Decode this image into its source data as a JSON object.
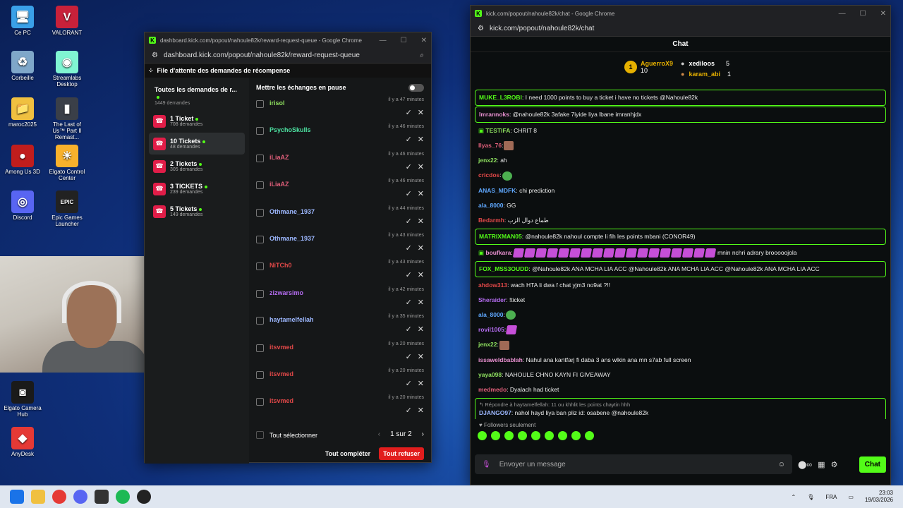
{
  "desktop": {
    "icons": [
      {
        "label": "Ce PC",
        "color": "#3aa0e8",
        "glyph": "🖥"
      },
      {
        "label": "VALORANT",
        "color": "#c8213a",
        "glyph": "V"
      },
      {
        "label": "Corbeille",
        "color": "#7fa7c9",
        "glyph": "♻"
      },
      {
        "label": "Streamlabs Desktop",
        "color": "#80f5d2",
        "glyph": "◉"
      },
      {
        "label": "maroc2025",
        "color": "#f0c040",
        "glyph": "📁"
      },
      {
        "label": "The Last of Us™ Part II Remast...",
        "color": "#3a3f48",
        "glyph": "▮"
      },
      {
        "label": "Among Us 3D",
        "color": "#c01d1d",
        "glyph": "●"
      },
      {
        "label": "Elgato Control Center",
        "color": "#f8b12c",
        "glyph": "☀"
      },
      {
        "label": "Discord",
        "color": "#5865f2",
        "glyph": "◎"
      },
      {
        "label": "Epic Games Launcher",
        "color": "#222",
        "glyph": "EPIC"
      },
      {
        "label": "Elgato Camera Hub",
        "color": "#1a1a1a",
        "glyph": "◙"
      },
      {
        "label": "AnyDesk",
        "color": "#e53935",
        "glyph": "◆"
      }
    ]
  },
  "dashboard": {
    "window_title": "dashboard.kick.com/popout/nahoule82k/reward-request-queue - Google Chrome",
    "url": "dashboard.kick.com/popout/nahoule82k/reward-request-queue",
    "header": "File d'attente des demandes de récompense",
    "sidebar": {
      "all_label": "Toutes les demandes de r...",
      "all_count": "1449 demandes",
      "items": [
        {
          "name": "1 Ticket",
          "count": "708 demandes"
        },
        {
          "name": "10 Tickets",
          "count": "48 demandes"
        },
        {
          "name": "2 Tickets",
          "count": "305 demandes"
        },
        {
          "name": "3 TICKETS",
          "count": "239 demandes"
        },
        {
          "name": "5 Tickets",
          "count": "149 demandes"
        }
      ]
    },
    "pause_label": "Mettre les échanges en pause",
    "requests": [
      {
        "user": "irisol",
        "color": "#8ee05f",
        "time": "il y a 47 minutes"
      },
      {
        "user": "PsychoSkulls",
        "color": "#4ce0a0",
        "time": "il y a 46 minutes"
      },
      {
        "user": "iLiaAZ",
        "color": "#e05f7a",
        "time": "il y a 46 minutes"
      },
      {
        "user": "iLiaAZ",
        "color": "#e05f7a",
        "time": "il y a 46 minutes"
      },
      {
        "user": "Othmane_1937",
        "color": "#9db8ff",
        "time": "il y a 44 minutes"
      },
      {
        "user": "Othmane_1937",
        "color": "#9db8ff",
        "time": "il y a 43 minutes"
      },
      {
        "user": "NiTCh0",
        "color": "#e04848",
        "time": "il y a 43 minutes"
      },
      {
        "user": "zizwarsimo",
        "color": "#b46cf0",
        "time": "il y a 42 minutes"
      },
      {
        "user": "haytamelfellah",
        "color": "#9db8ff",
        "time": "il y a 35 minutes"
      },
      {
        "user": "itsvmed",
        "color": "#e04848",
        "time": "il y a 20 minutes"
      },
      {
        "user": "itsvmed",
        "color": "#e04848",
        "time": "il y a 20 minutes"
      },
      {
        "user": "itsvmed",
        "color": "#e04848",
        "time": "il y a 20 minutes"
      }
    ],
    "select_all": "Tout sélectionner",
    "page": "1 sur 2",
    "complete_all": "Tout compléter",
    "refuse_all": "Tout refuser"
  },
  "chat": {
    "window_title": "kick.com/popout/nahoule82k/chat - Google Chrome",
    "url": "kick.com/popout/nahoule82k/chat",
    "title": "Chat",
    "leaderboard": {
      "first": {
        "rank": "1",
        "name": "AguerroX9",
        "value": "10"
      },
      "second": {
        "name": "xediloos",
        "value": "5"
      },
      "third": {
        "name": "karam_abi",
        "value": "1"
      }
    },
    "messages": [
      {
        "user": "MUKE_L3ROBI",
        "color": "#53fc18",
        "text": ": I need 1000 points to buy a ticket i have no tickets @Nahoule82k",
        "hl": true
      },
      {
        "user": "Imrannoks",
        "color": "#e890d0",
        "text": ": @nahoule82k 3afake 7iyide liya lbane imranhjdx",
        "hl": true
      },
      {
        "user": "TESTIFA",
        "color": "#8ee05f",
        "text": ": CHRIT 8",
        "badge": true
      },
      {
        "user": "Ilyas_76",
        "color": "#e05f7a",
        "text": ":",
        "emotes": [
          "d"
        ]
      },
      {
        "user": "jenx22",
        "color": "#8ee05f",
        "text": ": ah"
      },
      {
        "user": "cricdos",
        "color": "#e04848",
        "text": ":",
        "emotes": [
          "g"
        ]
      },
      {
        "user": "ANAS_MDFK",
        "color": "#5fa8ff",
        "text": ": chi prediction"
      },
      {
        "user": "ala_8000",
        "color": "#5fa8ff",
        "text": ": GG"
      },
      {
        "user": "Bedarmh",
        "color": "#e04848",
        "text": ": طماع دوال الزب"
      },
      {
        "user": "MATRIXMAN05",
        "color": "#53fc18",
        "text": ": @nahoule82k nahoul compte li fih les points mbani (CONOR49)",
        "hl": true
      },
      {
        "user": "boufkara",
        "color": "#e890d0",
        "text": ":",
        "emotes": [
          "p",
          "p",
          "p",
          "p",
          "p",
          "p",
          "p",
          "p",
          "p",
          "p",
          "p",
          "p",
          "p",
          "p",
          "p",
          "p",
          "p",
          "p"
        ],
        "after": " mnin nchri adrary brooooojola",
        "badge": true
      },
      {
        "user": "FOX_MSS3OUDD",
        "color": "#53fc18",
        "text": ": @Nahoule82k ANA MCHA LIA ACC @Nahoule82k ANA MCHA LIA ACC @Nahoule82k ANA MCHA LIA ACC",
        "hl": true
      },
      {
        "user": "ahdow313",
        "color": "#e04848",
        "text": ": wach HTA li dwa f chat yjm3 no9at ?!!"
      },
      {
        "user": "Sheraider",
        "color": "#b46cf0",
        "text": ": !ticket"
      },
      {
        "user": "ala_8000",
        "color": "#5fa8ff",
        "text": ":",
        "emotes": [
          "g"
        ]
      },
      {
        "user": "rovil1005",
        "color": "#b46cf0",
        "text": ":",
        "emotes": [
          "p"
        ]
      },
      {
        "user": "jenx22",
        "color": "#8ee05f",
        "text": ":",
        "emotes": [
          "d"
        ]
      },
      {
        "user": "issaweldbablah",
        "color": "#e890d0",
        "text": ": Nahul ana kantfarj fi daba 3 ans wlkin ana mn s7ab full screen"
      },
      {
        "user": "yaya098",
        "color": "#8ee05f",
        "text": ": NAHOULE CHNO KAYN FI GIVEAWAY"
      },
      {
        "user": "medmedo",
        "color": "#e05f7a",
        "text": ": Dyalach had ticket"
      },
      {
        "user": "DJANGO97",
        "color": "#9db8ff",
        "text": ": nahol hayd liya ban pliz id: osabene @nahoule82k",
        "hl": true,
        "reply": "↰ Répondre à haytamelfellah: 11 ou khhlit les points chaytin hhh"
      },
      {
        "user": "jenx22",
        "color": "#8ee05f",
        "text": ":",
        "emotes": [
          "d"
        ]
      }
    ],
    "followers_only": "♥ Followers seulement",
    "input_placeholder": "Envoyer un message",
    "send_label": "Chat"
  },
  "taskbar": {
    "lang": "FRA",
    "time": "23:03",
    "date": "19/03/2026"
  }
}
